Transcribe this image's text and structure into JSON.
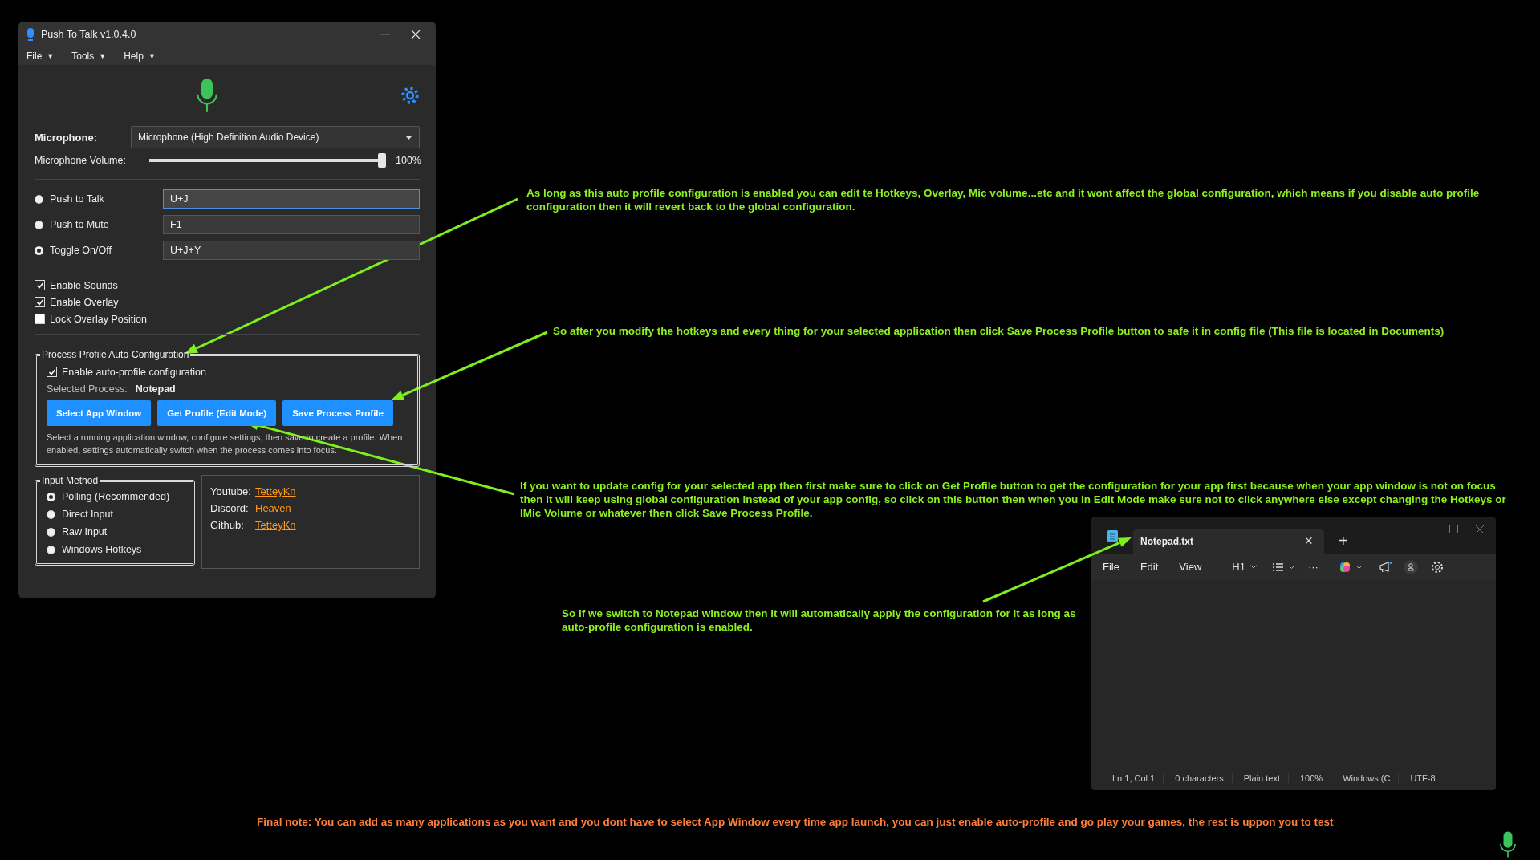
{
  "ptt_window": {
    "title": "Push To Talk v1.0.4.0",
    "menu": [
      {
        "label": "File",
        "arrow": "▼"
      },
      {
        "label": "Tools",
        "arrow": "▼"
      },
      {
        "label": "Help",
        "arrow": "▼"
      }
    ],
    "microphone": {
      "label": "Microphone:",
      "value": "Microphone (High Definition Audio Device)"
    },
    "volume": {
      "label": "Microphone Volume:",
      "level": 1.0,
      "reading": "100%"
    },
    "modes": [
      {
        "label": "Push to Talk",
        "value": "U+J",
        "selected": false,
        "focused": true
      },
      {
        "label": "Push to Mute",
        "value": "F1",
        "selected": false,
        "focused": false
      },
      {
        "label": "Toggle On/Off",
        "value": "U+J+Y",
        "selected": true,
        "focused": false
      }
    ],
    "options": [
      {
        "label": "Enable Sounds",
        "checked": true
      },
      {
        "label": "Enable Overlay",
        "checked": true
      },
      {
        "label": "Lock Overlay Position",
        "checked": false
      }
    ],
    "profile": {
      "legend": "Process Profile Auto-Configuration",
      "enable": {
        "label": "Enable auto-profile configuration",
        "checked": true
      },
      "selected_label": "Selected Process:",
      "selected_value": "Notepad",
      "buttons": [
        "Select App Window",
        "Get Profile (Edit Mode)",
        "Save Process Profile"
      ],
      "help": "Select a running application window, configure settings, then save to create a profile. When enabled, settings automatically switch when the process comes into focus."
    },
    "input_method": {
      "legend": "Input Method",
      "options": [
        {
          "label": "Polling (Recommended)",
          "selected": true
        },
        {
          "label": "Direct Input",
          "selected": false
        },
        {
          "label": "Raw Input",
          "selected": false
        },
        {
          "label": "Windows Hotkeys",
          "selected": false
        }
      ]
    },
    "links": [
      {
        "label": "Youtube:",
        "value": "TetteyKn"
      },
      {
        "label": "Discord:",
        "value": "Heaven"
      },
      {
        "label": "Github:",
        "value": "TetteyKn"
      }
    ]
  },
  "notepad_window": {
    "tab": "Notepad.txt",
    "tab_close": "×",
    "new_tab": "+",
    "menu": [
      "File",
      "Edit",
      "View"
    ],
    "heading": "H1",
    "more": "···",
    "status_bar": [
      "Ln 1, Col 1",
      "0 characters",
      "Plain text",
      "100%",
      "Windows (C",
      "UTF-8"
    ]
  },
  "annotations": [
    {
      "text": "As long as this auto profile configuration is enabled you can edit te Hotkeys, Overlay, Mic volume...etc and it wont affect the global configuration, which means if you disable auto profile configuration then it will revert back to the global configuration.",
      "color": "#8cf01e"
    },
    {
      "text": "So after you modify the hotkeys and every thing for your selected application then click Save Process Profile button to safe it in config file (This file is located in Documents)",
      "color": "#8cf01e"
    },
    {
      "text": "If you want to update config for your selected app then first make sure to click on Get Profile button to get the configuration for your app first because when your app window is not on focus then it will keep using global configuration instead of your app config, so click on this button then when you in Edit Mode make sure not to click anywhere else except changing the Hotkeys or IMic Volume or whatever then click Save Process Profile.",
      "color": "#8cf01e"
    },
    {
      "text": "So if we switch to Notepad window then it will automatically apply the configuration for it as long as auto-profile configuration is enabled.",
      "color": "#8cf01e"
    },
    {
      "text": "Final note: You can add as many applications as you want and you dont have to select App Window every  time app launch, you can just enable auto-profile and go play your games, the rest is uppon you to test",
      "color": "#ff7f3a"
    }
  ]
}
